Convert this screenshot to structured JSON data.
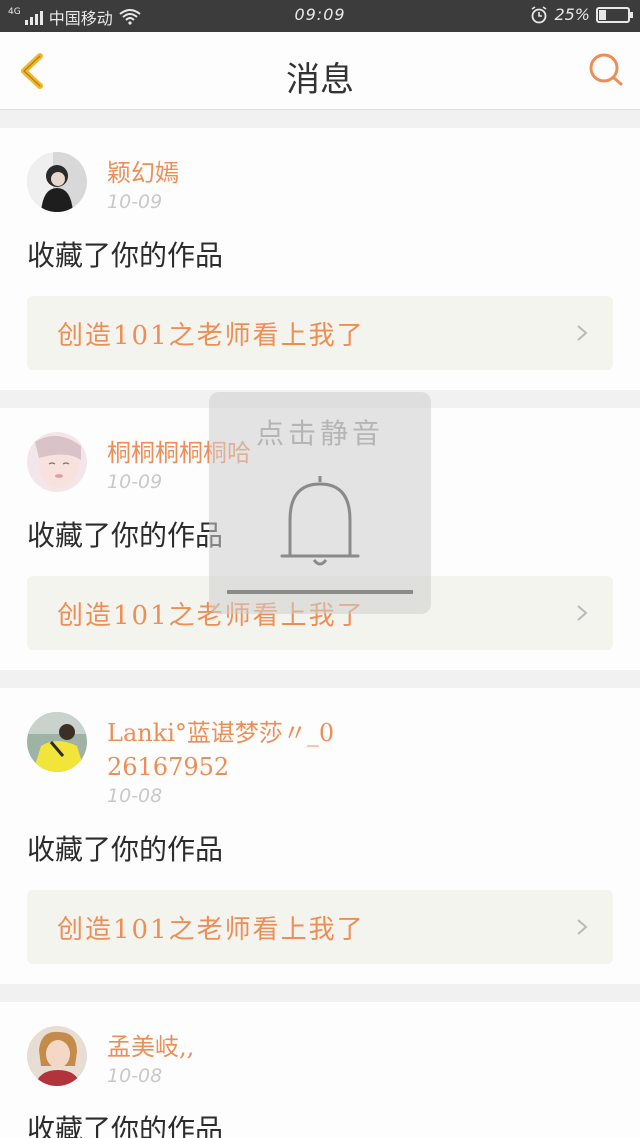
{
  "status_bar": {
    "network": "4G",
    "carrier": "中国移动",
    "time": "09:09",
    "battery_percent": "25%",
    "battery_level": 0.25
  },
  "navbar": {
    "title": "消息",
    "back_icon": "chevron-left-icon",
    "search_icon": "search-icon",
    "accent_color": "#ee8e57"
  },
  "messages": [
    {
      "nickname": "颖幻嫣",
      "date": "10-09",
      "action": "收藏了你的作品",
      "work_title": "创造101之老师看上我了"
    },
    {
      "nickname": "桐桐桐桐桐哈",
      "date": "10-09",
      "action": "收藏了你的作品",
      "work_title": "创造101之老师看上我了"
    },
    {
      "nickname": "Lanki°蓝谌梦莎〃_026167952",
      "date": "10-08",
      "action": "收藏了你的作品",
      "work_title": "创造101之老师看上我了"
    },
    {
      "nickname": "孟美岐,,",
      "date": "10-08",
      "action": "收藏了你的作品",
      "work_title": ""
    }
  ],
  "mute_overlay": {
    "label": "点击静音",
    "icon": "bell-icon"
  }
}
